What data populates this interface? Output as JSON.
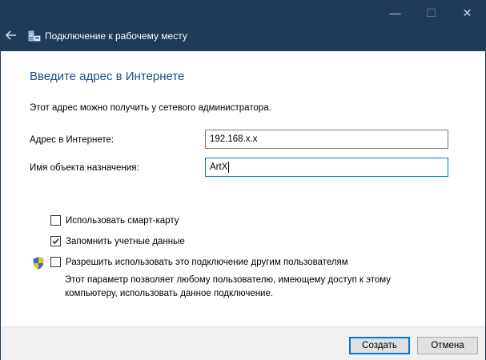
{
  "window": {
    "title": "Подключение к рабочему месту",
    "controls": {
      "minimize": "—",
      "maximize": "☐",
      "close": "✕"
    }
  },
  "page": {
    "heading": "Введите адрес в Интернете",
    "info": "Этот адрес можно получить у сетевого администратора."
  },
  "fields": {
    "address_label": "Адрес в Интернете:",
    "address_value": "192.168.x.x",
    "name_label": "Имя объекта назначения:",
    "name_value": "ArtX"
  },
  "options": {
    "smartcard": {
      "label": "Использовать смарт-карту",
      "checked": false
    },
    "remember": {
      "label": "Запомнить учетные данные",
      "checked": true
    },
    "share": {
      "label": "Разрешить использовать это подключение другим пользователям",
      "checked": false
    },
    "share_desc": "Этот параметр позволяет любому пользователю, имеющему доступ к этому компьютеру, использовать данное подключение."
  },
  "buttons": {
    "create": "Создать",
    "cancel": "Отмена"
  },
  "colors": {
    "titlebar": "#1f3b5a",
    "heading": "#1a4f8a",
    "accent": "#0078d7"
  }
}
